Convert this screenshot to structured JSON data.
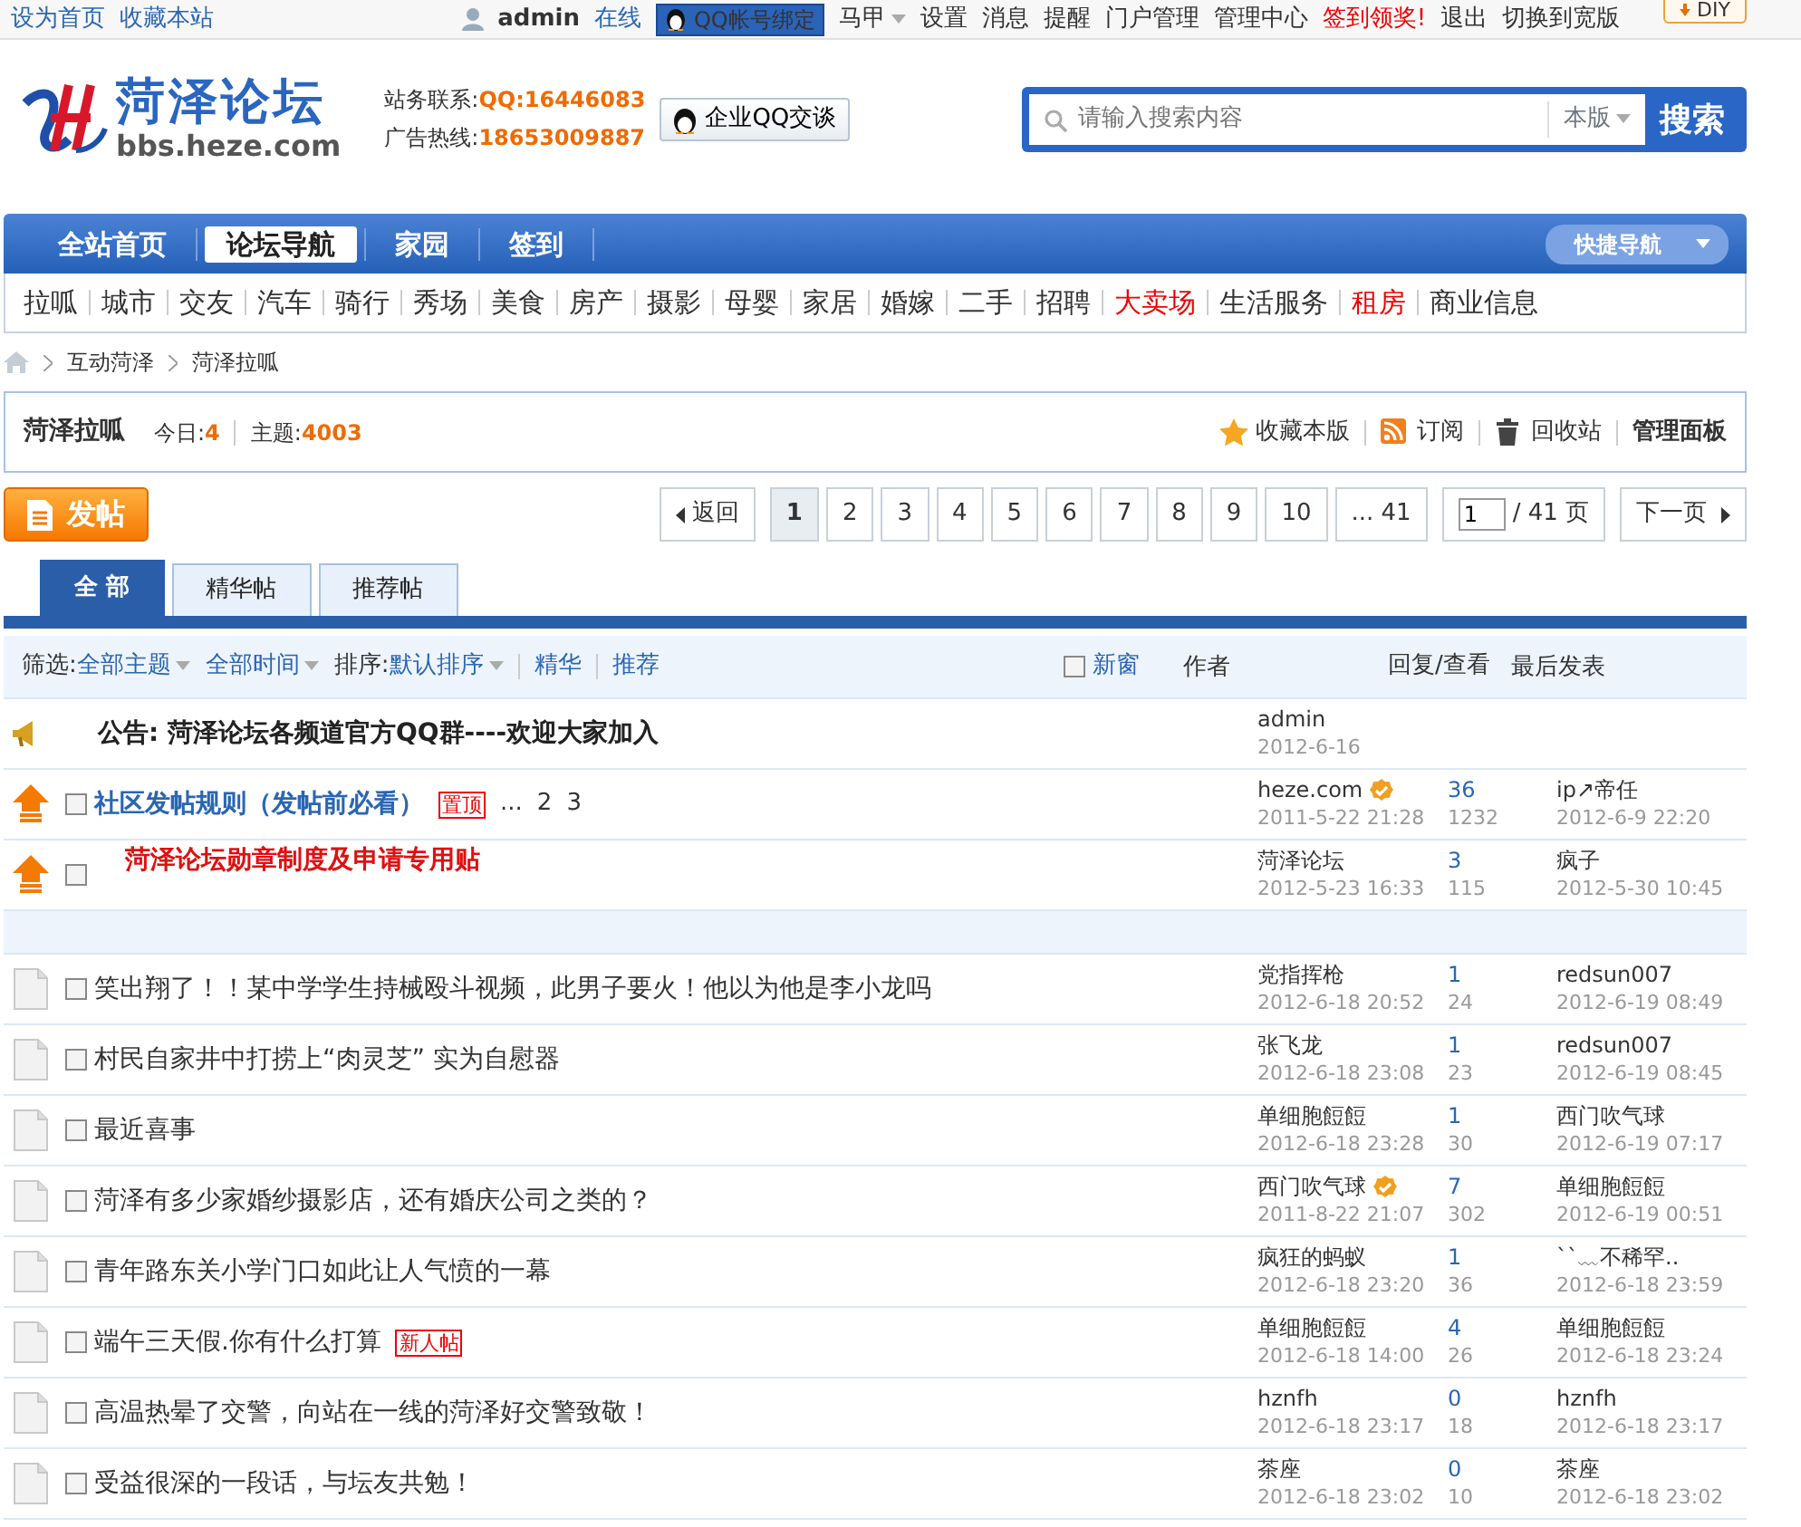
{
  "topbar": {
    "left_links": [
      "设为首页",
      "收藏本站"
    ],
    "user": "admin",
    "status": "在线",
    "qq_bind": "QQ帐号绑定",
    "links": [
      {
        "label": "马甲",
        "kind": "dropdown"
      },
      {
        "label": "设置",
        "kind": "plain"
      },
      {
        "label": "消息",
        "kind": "plain"
      },
      {
        "label": "提醒",
        "kind": "plain"
      },
      {
        "label": "门户管理",
        "kind": "plain"
      },
      {
        "label": "管理中心",
        "kind": "plain"
      },
      {
        "label": "签到领奖!",
        "kind": "alert"
      },
      {
        "label": "退出",
        "kind": "plain"
      },
      {
        "label": "切换到宽版",
        "kind": "plain"
      }
    ],
    "diy": "DIY"
  },
  "header": {
    "logo_title": "菏泽论坛",
    "logo_url": "bbs.heze.com",
    "contacts": [
      {
        "label": "站务联系:",
        "value": "QQ:16446083"
      },
      {
        "label": "广告热线:",
        "value": "18653009887"
      }
    ],
    "qq_chat": "企业QQ交谈",
    "search": {
      "placeholder": "请输入搜索内容",
      "scope": "本版",
      "button": "搜索"
    }
  },
  "main_nav": {
    "items": [
      {
        "label": "全站首页",
        "selected": false
      },
      {
        "label": "论坛导航",
        "selected": true
      },
      {
        "label": "家园",
        "selected": false
      },
      {
        "label": "签到",
        "selected": false
      }
    ],
    "quick_nav": "快捷导航"
  },
  "sub_nav": [
    {
      "label": "拉呱",
      "highlight": false
    },
    {
      "label": "城市",
      "highlight": false
    },
    {
      "label": "交友",
      "highlight": false
    },
    {
      "label": "汽车",
      "highlight": false
    },
    {
      "label": "骑行",
      "highlight": false
    },
    {
      "label": "秀场",
      "highlight": false
    },
    {
      "label": "美食",
      "highlight": false
    },
    {
      "label": "房产",
      "highlight": false
    },
    {
      "label": "摄影",
      "highlight": false
    },
    {
      "label": "母婴",
      "highlight": false
    },
    {
      "label": "家居",
      "highlight": false
    },
    {
      "label": "婚嫁",
      "highlight": false
    },
    {
      "label": "二手",
      "highlight": false
    },
    {
      "label": "招聘",
      "highlight": false
    },
    {
      "label": "大卖场",
      "highlight": true
    },
    {
      "label": "生活服务",
      "highlight": false
    },
    {
      "label": "租房",
      "highlight": true
    },
    {
      "label": "商业信息",
      "highlight": false
    }
  ],
  "breadcrumb": [
    "互动菏泽",
    "菏泽拉呱"
  ],
  "forum": {
    "name": "菏泽拉呱",
    "today_label": "今日:",
    "today": "4",
    "topics_label": "主题:",
    "topics": "4003",
    "actions": [
      {
        "label": "收藏本版",
        "kind": "star"
      },
      {
        "label": "订阅",
        "kind": "rss"
      },
      {
        "label": "回收站",
        "kind": "trash"
      },
      {
        "label": "管理面板",
        "kind": "strong"
      }
    ]
  },
  "post_button": "发帖",
  "pagination": {
    "back": "返回",
    "pages": [
      {
        "label": "1",
        "selected": true
      },
      {
        "label": "2",
        "selected": false
      },
      {
        "label": "3",
        "selected": false
      },
      {
        "label": "4",
        "selected": false
      },
      {
        "label": "5",
        "selected": false
      },
      {
        "label": "6",
        "selected": false
      },
      {
        "label": "7",
        "selected": false
      },
      {
        "label": "8",
        "selected": false
      },
      {
        "label": "9",
        "selected": false
      },
      {
        "label": "10",
        "selected": false
      },
      {
        "label": "... 41",
        "selected": false
      }
    ],
    "page_value": "1",
    "total": "/ 41 页",
    "next": "下一页"
  },
  "tabs": [
    {
      "label": "全 部",
      "selected": true
    },
    {
      "label": "精华帖",
      "selected": false
    },
    {
      "label": "推荐帖",
      "selected": false
    }
  ],
  "filters": [
    {
      "prefix": "筛选:",
      "label": "全部主题",
      "dropdown": true
    },
    {
      "label": "全部时间",
      "dropdown": true
    },
    {
      "prefix": "排序:",
      "label": "默认排序",
      "dropdown": true
    },
    {
      "label": "精华",
      "dropdown": false
    },
    {
      "label": "推荐",
      "dropdown": false
    }
  ],
  "new_window": {
    "label": "新窗",
    "checked": false
  },
  "columns": {
    "author": "作者",
    "replies": "回复/查看",
    "last": "最后发表"
  },
  "threads": [
    {
      "kind": "announcement",
      "title": "公告: 菏泽论坛各频道官方QQ群----欢迎大家加入",
      "author": "admin",
      "author_date": "2012-6-16"
    },
    {
      "kind": "sticky",
      "checked": false,
      "title": "社区发帖规则（发帖前必看）",
      "tag": "置顶",
      "page_links": [
        "...",
        "2",
        "3"
      ],
      "author": "heze.com",
      "verified": true,
      "author_date": "2011-5-22 21:28",
      "replies": "36",
      "views": "1232",
      "last_user": "ip↗帝任",
      "last_date": "2012-6-9 22:20"
    },
    {
      "kind": "alert_sticky",
      "checked": false,
      "title": "菏泽论坛勋章制度及申请专用贴",
      "author": "菏泽论坛",
      "author_date": "2012-5-23 16:33",
      "replies": "3",
      "views": "115",
      "last_user": "疯子",
      "last_date": "2012-5-30 10:45"
    },
    {
      "kind": "separator"
    },
    {
      "kind": "normal",
      "checked": false,
      "title": "笑出翔了！！某中学学生持械殴斗视频，此男子要火！他以为他是李小龙吗",
      "author": "党指挥枪",
      "author_date": "2012-6-18 20:52",
      "replies": "1",
      "views": "24",
      "last_user": "redsun007",
      "last_date": "2012-6-19 08:49"
    },
    {
      "kind": "normal",
      "checked": false,
      "title": "村民自家井中打捞上“肉灵芝” 实为自慰器",
      "author": "张飞龙",
      "author_date": "2012-6-18 23:08",
      "replies": "1",
      "views": "23",
      "last_user": "redsun007",
      "last_date": "2012-6-19 08:45"
    },
    {
      "kind": "normal",
      "checked": false,
      "title": "最近喜事",
      "author": "单细胞餖餖",
      "author_date": "2012-6-18 23:28",
      "replies": "1",
      "views": "30",
      "last_user": "西门吹气球",
      "last_date": "2012-6-19 07:17"
    },
    {
      "kind": "normal",
      "checked": false,
      "title": "菏泽有多少家婚纱摄影店，还有婚庆公司之类的？",
      "author": "西门吹气球",
      "verified": true,
      "author_date": "2011-8-22 21:07",
      "replies": "7",
      "views": "302",
      "last_user": "单细胞餖餖",
      "last_date": "2012-6-19 00:51"
    },
    {
      "kind": "normal",
      "checked": false,
      "title": "青年路东关小学门口如此让人气愤的一幕",
      "author": "疯狂的蚂蚁",
      "author_date": "2012-6-18 23:20",
      "replies": "1",
      "views": "36",
      "last_user": "``﹏不稀罕..",
      "last_date": "2012-6-18 23:59"
    },
    {
      "kind": "normal",
      "checked": false,
      "title": "端午三天假.你有什么打算",
      "tag": "新人帖",
      "author": "单细胞餖餖",
      "author_date": "2012-6-18 14:00",
      "replies": "4",
      "views": "26",
      "last_user": "单细胞餖餖",
      "last_date": "2012-6-18 23:24"
    },
    {
      "kind": "normal",
      "checked": false,
      "title": "高温热晕了交警，向站在一线的菏泽好交警致敬！",
      "author": "hznfh",
      "author_date": "2012-6-18 23:17",
      "replies": "0",
      "views": "18",
      "last_user": "hznfh",
      "last_date": "2012-6-18 23:17"
    },
    {
      "kind": "normal",
      "checked": false,
      "title": "受益很深的一段话，与坛友共勉！",
      "author": "茶座",
      "author_date": "2012-6-18 23:02",
      "replies": "0",
      "views": "10",
      "last_user": "茶座",
      "last_date": "2012-6-18 23:02"
    }
  ]
}
